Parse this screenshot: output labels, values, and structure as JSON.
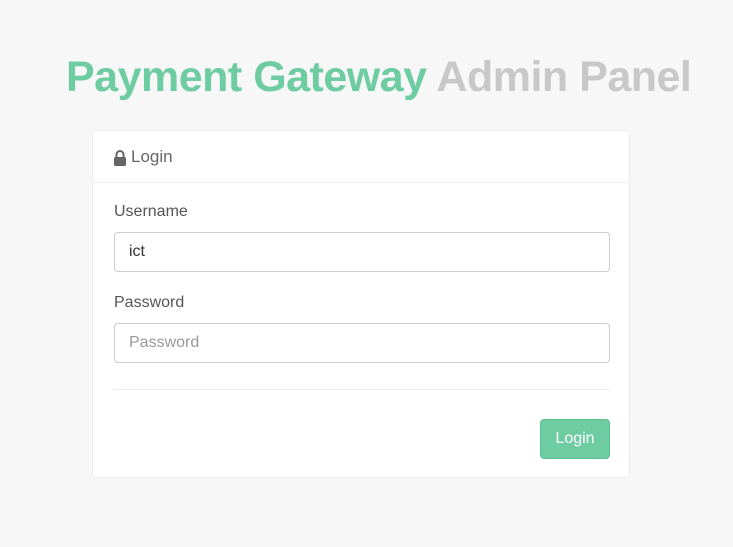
{
  "header": {
    "title_primary": "Payment Gateway",
    "title_secondary": "Admin Panel"
  },
  "login_card": {
    "header_label": "Login",
    "header_icon": "lock-icon",
    "username": {
      "label": "Username",
      "value": "ict"
    },
    "password": {
      "label": "Password",
      "value": "",
      "placeholder": "Password"
    },
    "submit_label": "Login"
  },
  "colors": {
    "accent": "#6dcca2",
    "muted_title": "#c8c8c8",
    "background": "#f7f7f7"
  }
}
